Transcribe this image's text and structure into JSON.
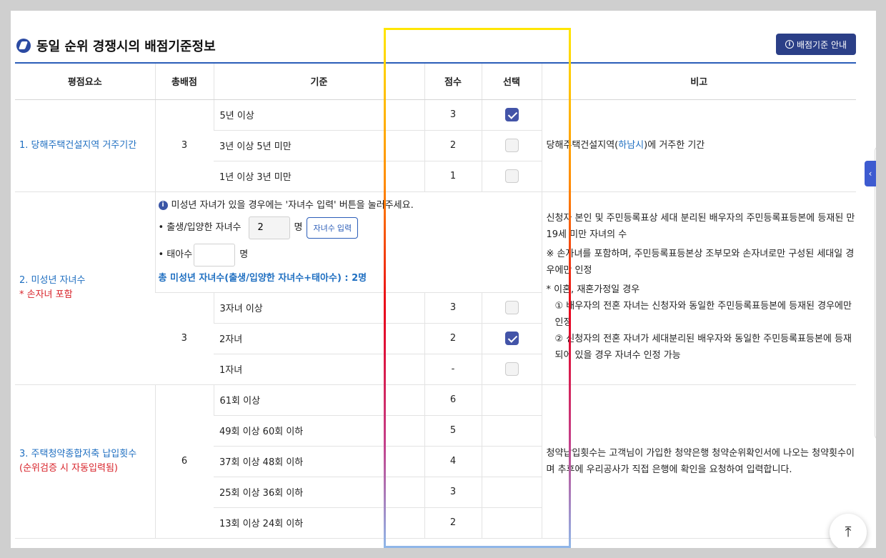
{
  "title": "동일 순위 경쟁시의 배점기준정보",
  "guide_button": "배점기준 안내",
  "headers": [
    "평점요소",
    "총배점",
    "기준",
    "점수",
    "선택",
    "비고"
  ],
  "section1": {
    "factor": "1. 당해주택건설지역 거주기간",
    "total": "3",
    "rows": [
      {
        "criterion": "5년 이상",
        "score": "3",
        "checked": true
      },
      {
        "criterion": "3년 이상 5년 미만",
        "score": "2",
        "checked": false
      },
      {
        "criterion": "1년 이상 3년 미만",
        "score": "1",
        "checked": false
      }
    ],
    "note_prefix": "당해주택건설지역(",
    "note_city": "하남시",
    "note_suffix": ")에 거주한 기간"
  },
  "section2": {
    "factor": "2. 미성년 자녀수",
    "factor_sub": "* 손자녀 포함",
    "info": "미성년 자녀가 있을 경우에는 '자녀수 입력' 버튼을 눌러주세요.",
    "birth_label": "• 출생/입양한 자녀수",
    "birth_value": "2",
    "unit": "명",
    "input_button": "자녀수 입력",
    "fetus_label": "• 태아수",
    "fetus_value": "",
    "total_text": "총 미성년 자녀수(출생/입양한 자녀수+태아수) : 2명",
    "total": "3",
    "rows": [
      {
        "criterion": "3자녀 이상",
        "score": "3",
        "checked": false
      },
      {
        "criterion": "2자녀",
        "score": "2",
        "checked": true
      },
      {
        "criterion": "1자녀",
        "score": "-",
        "checked": false
      }
    ],
    "notes": [
      "신청자 본인 및 주민등록표상 세대 분리된 배우자의 주민등록표등본에 등재된 만 19세 미만 자녀의 수",
      "※ 손자녀를 포함하며, 주민등록표등본상 조부모와 손자녀로만 구성된 세대일 경우에만 인정",
      "* 이혼, 재혼가정일 경우",
      "① 배우자의 전혼 자녀는 신청자와 동일한 주민등록표등본에 등재된 경우에만 인정",
      "② 신청자의 전혼 자녀가 세대분리된 배우자와 동일한 주민등록표등본에 등재되어 있을 경우 자녀수 인정 가능"
    ]
  },
  "section3": {
    "factor": "3. 주택청약종합저축 납입횟수",
    "factor_sub": "(순위검증 시 자동입력됨)",
    "total": "6",
    "rows": [
      {
        "criterion": "61회 이상",
        "score": "6"
      },
      {
        "criterion": "49회 이상 60회 이하",
        "score": "5"
      },
      {
        "criterion": "37회 이상 48회 이하",
        "score": "4"
      },
      {
        "criterion": "25회 이상 36회 이하",
        "score": "3"
      },
      {
        "criterion": "13회 이상 24회 이하",
        "score": "2"
      }
    ],
    "note": "청약납입횟수는 고객님이 가입한 청약은행 청약순위확인서에 나오는 청약횟수이며 추후에 우리공사가 직접 은행에 확인을 요청하여 입력합니다."
  },
  "icons": {
    "title": "title-logo-icon",
    "guide": "info-circle-icon",
    "side_tab": "chevron-left-icon",
    "top": "arrow-up-to-top-icon"
  }
}
